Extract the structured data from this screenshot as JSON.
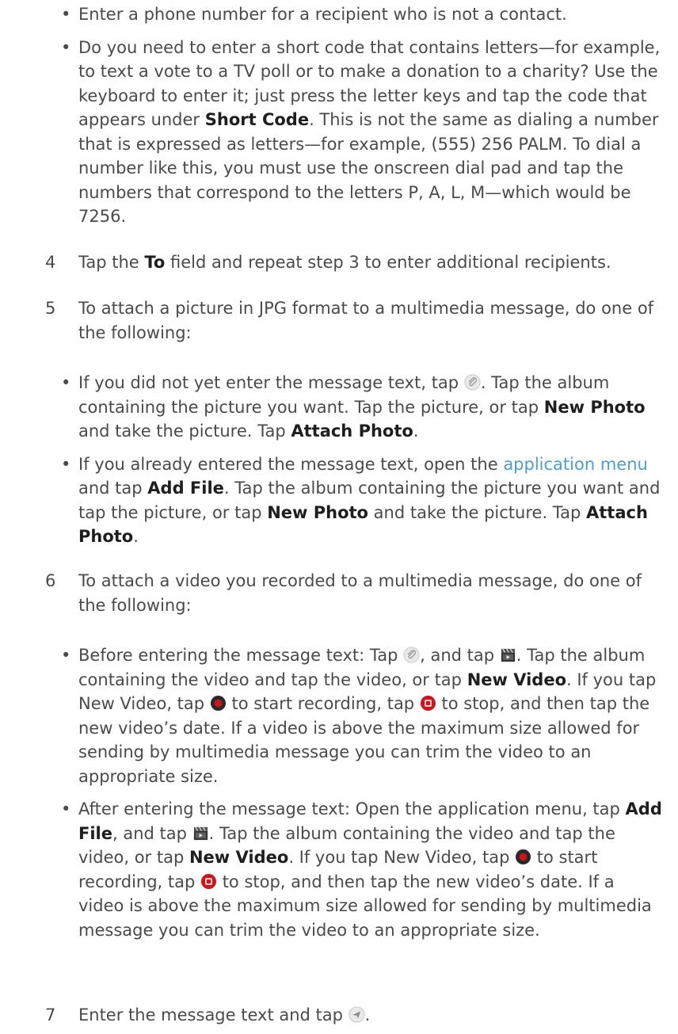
{
  "bullets_top": [
    "Enter a phone number for a recipient who is not a contact.",
    {
      "a": "Do you need to enter a short code that contains letters—for example, to text a vote to a TV poll or to make a donation to a charity? Use the keyboard to enter it; just press the letter keys and tap the code that appears under ",
      "b": "Short Code",
      "c": ". This is not the same as dialing a number that is expressed as letters—for example, (555) 256 PALM. To dial a number like this, you must use the onscreen dial pad and tap the numbers that correspond to the letters P, A, L, M—which would be 7256."
    }
  ],
  "step4": {
    "num": "4",
    "a": "Tap the ",
    "b": "To",
    "c": " field and repeat step 3 to enter additional recipients."
  },
  "step5": {
    "num": "5",
    "text": "To attach a picture in JPG format to a multimedia message, do one of the following:",
    "bullet1": {
      "a": "If you did not yet enter the message text, tap ",
      "b": ". Tap the album containing the picture you want. Tap the picture, or tap ",
      "c": "New Photo",
      "d": " and take the picture. Tap ",
      "e": "Attach Photo",
      "f": "."
    },
    "bullet2": {
      "a": "If you already entered the message text, open the ",
      "link": "application menu",
      "b": " and tap ",
      "c": "Add File",
      "d": ". Tap the album containing the picture you want and tap the picture, or tap ",
      "e": "New Photo",
      "f": " and take the picture. Tap ",
      "g": "Attach Photo",
      "h": "."
    }
  },
  "step6": {
    "num": "6",
    "text": "To attach a video you recorded to a multimedia message, do one of the following:",
    "bullet1": {
      "a": "Before entering the message text: Tap ",
      "b": ", and tap ",
      "c": ". Tap the album containing the video and tap the video, or tap ",
      "d": "New Video",
      "e": ". If you tap New Video, tap ",
      "f": " to start recording, tap ",
      "g": " to stop, and then tap the new video’s date. If a video is above the maximum size allowed for sending by multimedia message you can trim the video to an appropriate size."
    },
    "bullet2": {
      "a": "After entering the message text: Open the application menu, tap ",
      "b": "Add File",
      "c": ", and tap ",
      "d": ". Tap the album containing the video and tap the video, or tap ",
      "e": "New Video",
      "f": ". If you tap New Video, tap ",
      "g": " to start recording, tap ",
      "h": " to stop, and then tap the new video’s date. If a video is above the maximum size allowed for sending by multimedia message you can trim the video to an appropriate size."
    }
  },
  "step7": {
    "num": "7",
    "a": "Enter the message text and tap ",
    "b": "."
  },
  "icons": {
    "attach": "paperclip-icon",
    "video": "clapperboard-icon",
    "record": "record-icon",
    "stop": "stop-icon",
    "send": "send-icon"
  },
  "colors": {
    "body_text": "#4a4a4a",
    "bold_text": "#1e1e1e",
    "link": "#4b9fd6",
    "record_red": "#d0141a"
  }
}
